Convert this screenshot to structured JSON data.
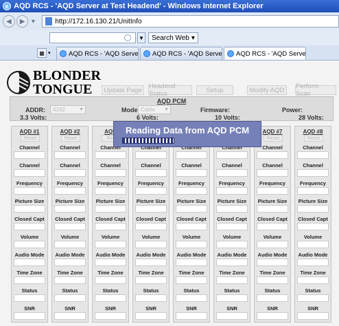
{
  "window": {
    "title": "AQD RCS - 'AQD Server at Test Headend' - Windows Internet Explorer"
  },
  "addressbar": {
    "url": "http://172.16.130.21/UnitInfo"
  },
  "search": {
    "label": "Search Web"
  },
  "tabs": [
    {
      "label": "AQD RCS - 'AQD Server at T..."
    },
    {
      "label": "AQD RCS - 'AQD Server at T..."
    },
    {
      "label": "AQD RCS - 'AQD Server a..."
    }
  ],
  "brand": {
    "line1": "BLONDER",
    "line2": "TONGUE"
  },
  "menu": {
    "update_page": "Update Page",
    "headend_status": "Headend Status",
    "setup": "Setup",
    "modify_aqd": "Modify AQD",
    "perform_scan": "Perform Scan"
  },
  "pcm": {
    "title": "AQD PCM",
    "addr_label": "ADDR:",
    "addr_value": "4192",
    "mode_label": "Mode:",
    "mode_value": "Cable",
    "firmware_label": "Firmware:",
    "power_label": "Power:",
    "v33_label": "3.3 Volts:",
    "v6_label": "6 Volts:",
    "v10_label": "10 Volts:",
    "v28_label": "28 Volts:"
  },
  "aqd_columns": [
    {
      "title": "AQD #1",
      "reset": "Reset"
    },
    {
      "title": "AQD #2",
      "reset": "Reset"
    },
    {
      "title": "AQD",
      "reset": "Res"
    },
    {
      "title": "",
      "reset": ""
    },
    {
      "title": "",
      "reset": ""
    },
    {
      "title": "",
      "reset": ""
    },
    {
      "title": "AQD #7",
      "reset": "Reset"
    },
    {
      "title": "AQD #8",
      "reset": "Reset"
    }
  ],
  "fields": [
    "Channel",
    "Channel Name",
    "Frequency",
    "Picture Size",
    "Closed Capt",
    "Volume",
    "Audio Mode",
    "Time Zone",
    "Status",
    "SNR"
  ],
  "popup": {
    "message": "Reading Data from AQD PCM"
  }
}
